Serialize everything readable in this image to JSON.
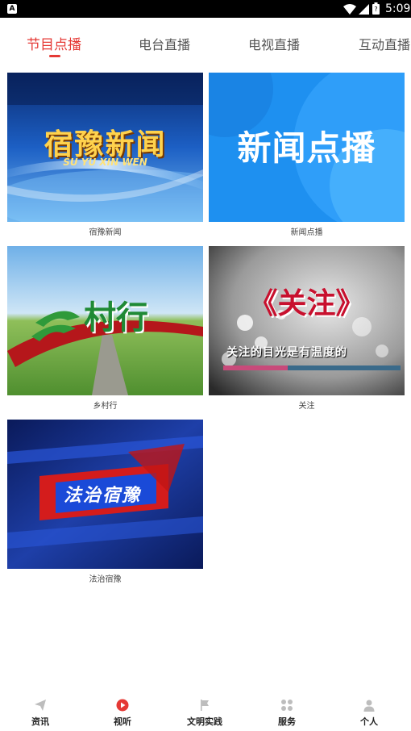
{
  "status_bar": {
    "time": "5:09",
    "app_icon": "A"
  },
  "tabs": [
    {
      "label": "节目点播",
      "active": true
    },
    {
      "label": "电台直播",
      "active": false
    },
    {
      "label": "电视直播",
      "active": false
    },
    {
      "label": "互动直播",
      "active": false
    }
  ],
  "programs": [
    {
      "caption": "宿豫新闻",
      "thumb_title": "宿豫新闻",
      "thumb_subtitle": "SU YU XIN WEN"
    },
    {
      "caption": "新闻点播",
      "thumb_title": "新闻点播"
    },
    {
      "caption": "乡村行",
      "thumb_title": "村行"
    },
    {
      "caption": "关注",
      "thumb_title": "《关注》",
      "thumb_subtitle": "关注的目光是有温度的"
    },
    {
      "caption": "法治宿豫",
      "thumb_title": "法治宿豫"
    }
  ],
  "bottom_nav": [
    {
      "label": "资讯",
      "icon": "paper-plane-icon",
      "active": false
    },
    {
      "label": "视听",
      "icon": "play-circle-icon",
      "active": true
    },
    {
      "label": "文明实践",
      "icon": "flag-icon",
      "active": false
    },
    {
      "label": "服务",
      "icon": "grid-icon",
      "active": false
    },
    {
      "label": "个人",
      "icon": "person-icon",
      "active": false
    }
  ],
  "colors": {
    "accent": "#e53935",
    "inactive_icon": "#bdbdbd"
  }
}
